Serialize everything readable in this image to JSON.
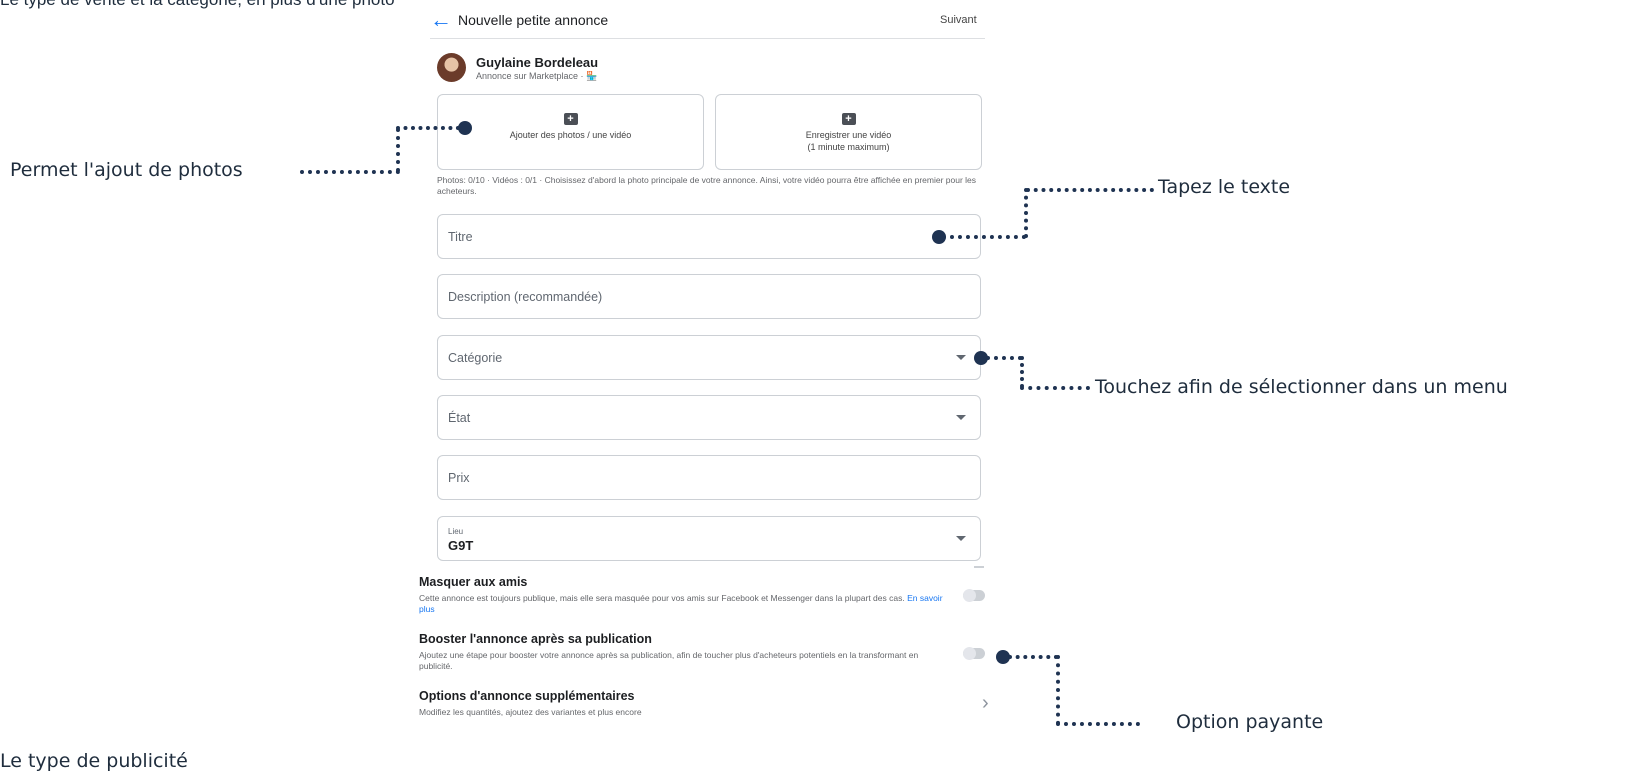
{
  "top_clipped_text": "Le type de vente et la catégorie, en plus d'une photo",
  "header": {
    "back_icon": "arrow-left-icon",
    "title": "Nouvelle petite annonce",
    "next_label": "Suivant"
  },
  "user": {
    "name": "Guylaine Bordeleau",
    "subtitle": "Annonce sur Marketplace · 🏪"
  },
  "media": {
    "add_photos_label": "Ajouter des photos / une vidéo",
    "record_video_line1": "Enregistrer une vidéo",
    "record_video_line2": "(1 minute maximum)",
    "note": "Photos: 0/10 · Vidéos : 0/1 · Choisissez d'abord la photo principale de votre annonce. Ainsi, votre vidéo pourra être affichée en premier pour les acheteurs."
  },
  "fields": {
    "title_placeholder": "Titre",
    "description_placeholder": "Description (recommandée)",
    "category_placeholder": "Catégorie",
    "condition_placeholder": "État",
    "price_placeholder": "Prix",
    "location_label": "Lieu",
    "location_value": "G9T"
  },
  "options": {
    "hide_title": "Masquer aux amis",
    "hide_desc": "Cette annonce est toujours publique, mais elle sera masquée pour vos amis sur Facebook et Messenger dans la plupart des cas.",
    "hide_link": "En savoir plus",
    "hide_enabled": false,
    "boost_title": "Booster l'annonce après sa publication",
    "boost_desc": "Ajoutez une étape pour booster votre annonce après sa publication, afin de toucher plus d'acheteurs potentiels en la transformant en publicité.",
    "boost_enabled": false,
    "more_title": "Options d'annonce supplémentaires",
    "more_desc": "Modifiez les quantités, ajoutez des variantes et plus encore"
  },
  "callouts": {
    "photos": "Permet l'ajout de photos",
    "text": "Tapez le texte",
    "menu": "Touchez afin de sélectionner dans un menu",
    "paid": "Option payante"
  },
  "bottom_clipped_text": "Le type de publicité",
  "colors": {
    "accent": "#1877f2",
    "callout": "#1f3352"
  }
}
